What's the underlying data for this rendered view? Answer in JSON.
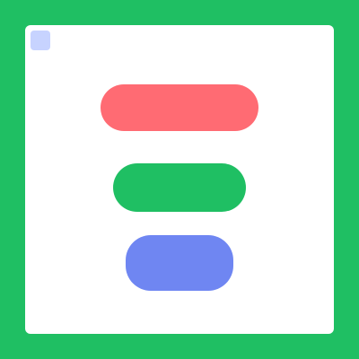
{
  "colors": {
    "frame": "#1fbf63",
    "red_button": "#ff6b73",
    "green_button": "#1fbf63",
    "blue_button": "#6f86f2",
    "corner_marker": "#c7d3ff"
  },
  "title": "",
  "buttons": {
    "red_label": "",
    "green_label": "",
    "blue_label": ""
  }
}
